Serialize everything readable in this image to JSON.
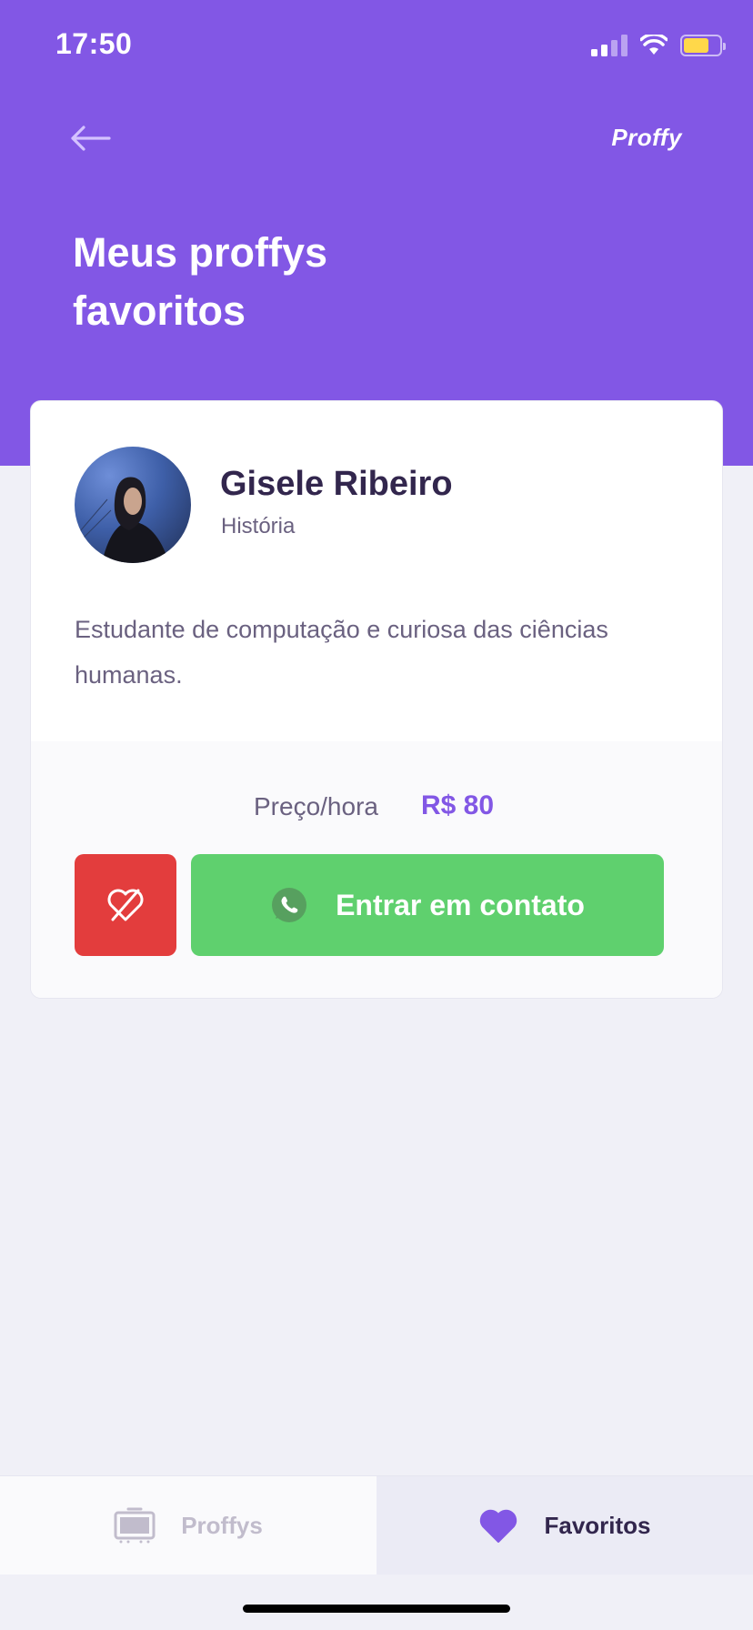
{
  "status_bar": {
    "time": "17:50"
  },
  "header": {
    "brand": "Proffy",
    "title": "Meus proffys favoritos"
  },
  "teacher": {
    "name": "Gisele Ribeiro",
    "subject": "História",
    "bio": "Estudante de computação e curiosa das ciências humanas.",
    "price_label": "Preço/hora",
    "price_value": "R$ 80",
    "contact_label": "Entrar em contato"
  },
  "tabs": [
    {
      "label": "Proffys",
      "active": false
    },
    {
      "label": "Favoritos",
      "active": true
    }
  ],
  "colors": {
    "primary": "#8257E5",
    "danger": "#E33D3D",
    "success": "#5FD06E",
    "title_dark": "#32264D",
    "text": "#6A6180"
  },
  "icons": {
    "back": "arrow-left-icon",
    "unfavorite": "heart-outline-icon",
    "contact": "whatsapp-icon",
    "tab_proffys": "tv-icon",
    "tab_favorites": "heart-filled-icon"
  }
}
